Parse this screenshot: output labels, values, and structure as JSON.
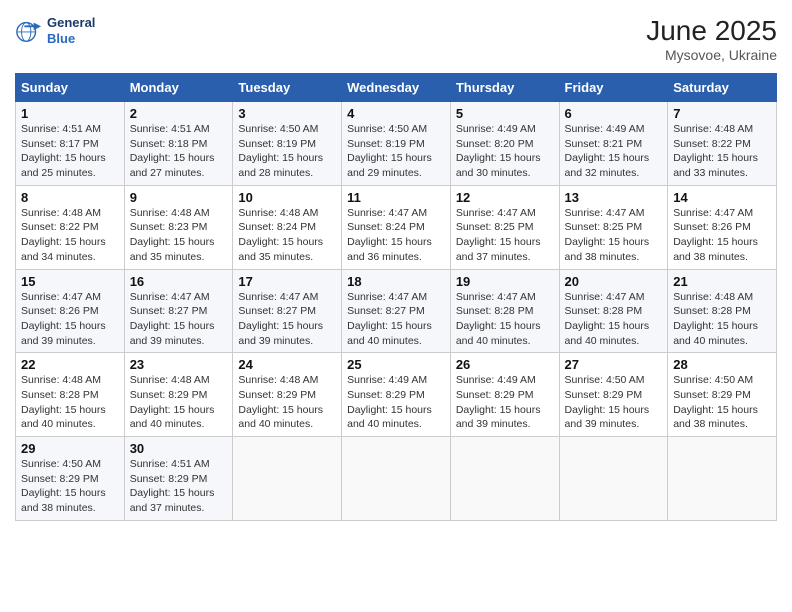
{
  "logo": {
    "general": "General",
    "blue": "Blue"
  },
  "title": "June 2025",
  "subtitle": "Mysovoe, Ukraine",
  "header": {
    "days": [
      "Sunday",
      "Monday",
      "Tuesday",
      "Wednesday",
      "Thursday",
      "Friday",
      "Saturday"
    ]
  },
  "weeks": [
    [
      {
        "date": "1",
        "sunrise": "4:51 AM",
        "sunset": "8:17 PM",
        "daylight": "15 hours and 25 minutes."
      },
      {
        "date": "2",
        "sunrise": "4:51 AM",
        "sunset": "8:18 PM",
        "daylight": "15 hours and 27 minutes."
      },
      {
        "date": "3",
        "sunrise": "4:50 AM",
        "sunset": "8:19 PM",
        "daylight": "15 hours and 28 minutes."
      },
      {
        "date": "4",
        "sunrise": "4:50 AM",
        "sunset": "8:19 PM",
        "daylight": "15 hours and 29 minutes."
      },
      {
        "date": "5",
        "sunrise": "4:49 AM",
        "sunset": "8:20 PM",
        "daylight": "15 hours and 30 minutes."
      },
      {
        "date": "6",
        "sunrise": "4:49 AM",
        "sunset": "8:21 PM",
        "daylight": "15 hours and 32 minutes."
      },
      {
        "date": "7",
        "sunrise": "4:48 AM",
        "sunset": "8:22 PM",
        "daylight": "15 hours and 33 minutes."
      }
    ],
    [
      {
        "date": "8",
        "sunrise": "4:48 AM",
        "sunset": "8:22 PM",
        "daylight": "15 hours and 34 minutes."
      },
      {
        "date": "9",
        "sunrise": "4:48 AM",
        "sunset": "8:23 PM",
        "daylight": "15 hours and 35 minutes."
      },
      {
        "date": "10",
        "sunrise": "4:48 AM",
        "sunset": "8:24 PM",
        "daylight": "15 hours and 35 minutes."
      },
      {
        "date": "11",
        "sunrise": "4:47 AM",
        "sunset": "8:24 PM",
        "daylight": "15 hours and 36 minutes."
      },
      {
        "date": "12",
        "sunrise": "4:47 AM",
        "sunset": "8:25 PM",
        "daylight": "15 hours and 37 minutes."
      },
      {
        "date": "13",
        "sunrise": "4:47 AM",
        "sunset": "8:25 PM",
        "daylight": "15 hours and 38 minutes."
      },
      {
        "date": "14",
        "sunrise": "4:47 AM",
        "sunset": "8:26 PM",
        "daylight": "15 hours and 38 minutes."
      }
    ],
    [
      {
        "date": "15",
        "sunrise": "4:47 AM",
        "sunset": "8:26 PM",
        "daylight": "15 hours and 39 minutes."
      },
      {
        "date": "16",
        "sunrise": "4:47 AM",
        "sunset": "8:27 PM",
        "daylight": "15 hours and 39 minutes."
      },
      {
        "date": "17",
        "sunrise": "4:47 AM",
        "sunset": "8:27 PM",
        "daylight": "15 hours and 39 minutes."
      },
      {
        "date": "18",
        "sunrise": "4:47 AM",
        "sunset": "8:27 PM",
        "daylight": "15 hours and 40 minutes."
      },
      {
        "date": "19",
        "sunrise": "4:47 AM",
        "sunset": "8:28 PM",
        "daylight": "15 hours and 40 minutes."
      },
      {
        "date": "20",
        "sunrise": "4:47 AM",
        "sunset": "8:28 PM",
        "daylight": "15 hours and 40 minutes."
      },
      {
        "date": "21",
        "sunrise": "4:48 AM",
        "sunset": "8:28 PM",
        "daylight": "15 hours and 40 minutes."
      }
    ],
    [
      {
        "date": "22",
        "sunrise": "4:48 AM",
        "sunset": "8:28 PM",
        "daylight": "15 hours and 40 minutes."
      },
      {
        "date": "23",
        "sunrise": "4:48 AM",
        "sunset": "8:29 PM",
        "daylight": "15 hours and 40 minutes."
      },
      {
        "date": "24",
        "sunrise": "4:48 AM",
        "sunset": "8:29 PM",
        "daylight": "15 hours and 40 minutes."
      },
      {
        "date": "25",
        "sunrise": "4:49 AM",
        "sunset": "8:29 PM",
        "daylight": "15 hours and 40 minutes."
      },
      {
        "date": "26",
        "sunrise": "4:49 AM",
        "sunset": "8:29 PM",
        "daylight": "15 hours and 39 minutes."
      },
      {
        "date": "27",
        "sunrise": "4:50 AM",
        "sunset": "8:29 PM",
        "daylight": "15 hours and 39 minutes."
      },
      {
        "date": "28",
        "sunrise": "4:50 AM",
        "sunset": "8:29 PM",
        "daylight": "15 hours and 38 minutes."
      }
    ],
    [
      {
        "date": "29",
        "sunrise": "4:50 AM",
        "sunset": "8:29 PM",
        "daylight": "15 hours and 38 minutes."
      },
      {
        "date": "30",
        "sunrise": "4:51 AM",
        "sunset": "8:29 PM",
        "daylight": "15 hours and 37 minutes."
      },
      null,
      null,
      null,
      null,
      null
    ]
  ]
}
